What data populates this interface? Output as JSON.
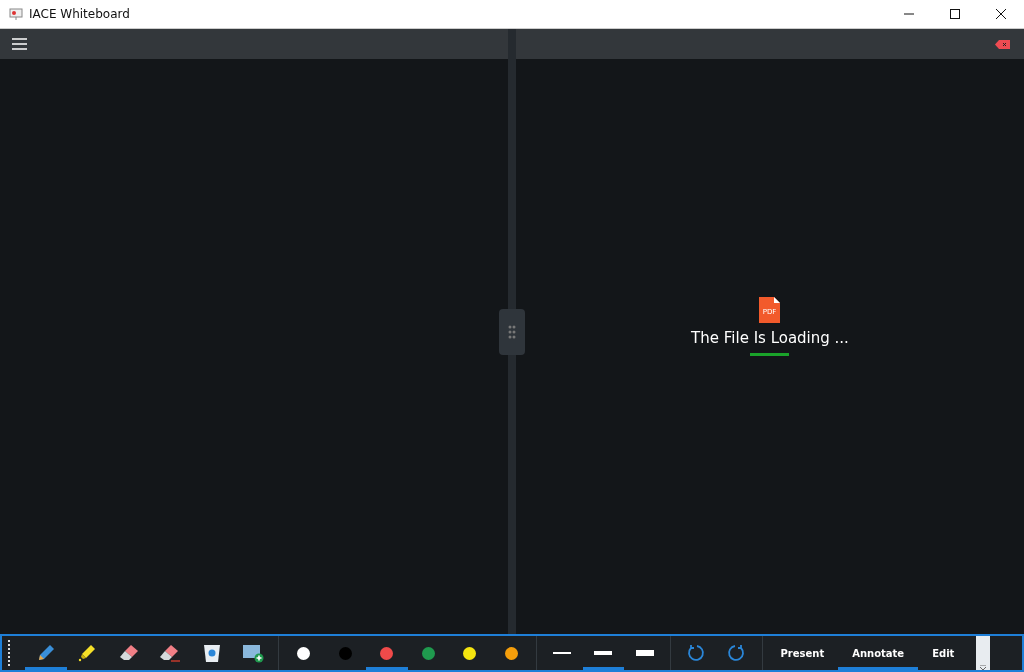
{
  "window": {
    "title": "IACE Whiteboard"
  },
  "viewer": {
    "file_label": "PDF",
    "message": "The File Is Loading ..."
  },
  "tools": [
    {
      "kind": "pen",
      "selected": true
    },
    {
      "kind": "highlighter",
      "selected": false
    },
    {
      "kind": "eraser",
      "selected": false
    },
    {
      "kind": "stroke-eraser",
      "selected": false
    },
    {
      "kind": "trash",
      "selected": false
    },
    {
      "kind": "add-page",
      "selected": false
    }
  ],
  "colors": [
    {
      "color": "#ffffff",
      "selected": false
    },
    {
      "color": "#000000",
      "selected": false
    },
    {
      "color": "#f04a4a",
      "selected": true
    },
    {
      "color": "#1f9a4e",
      "selected": false
    },
    {
      "color": "#f5e50f",
      "selected": false
    },
    {
      "color": "#f59e0b",
      "selected": false
    }
  ],
  "thickness": [
    {
      "kind": "thin",
      "selected": false
    },
    {
      "kind": "medium",
      "selected": true
    },
    {
      "kind": "thick",
      "selected": false
    }
  ],
  "history": [
    {
      "kind": "undo"
    },
    {
      "kind": "redo"
    }
  ],
  "modes": [
    {
      "label": "Present",
      "selected": false
    },
    {
      "label": "Annotate",
      "selected": true
    },
    {
      "label": "Edit",
      "selected": false
    }
  ]
}
